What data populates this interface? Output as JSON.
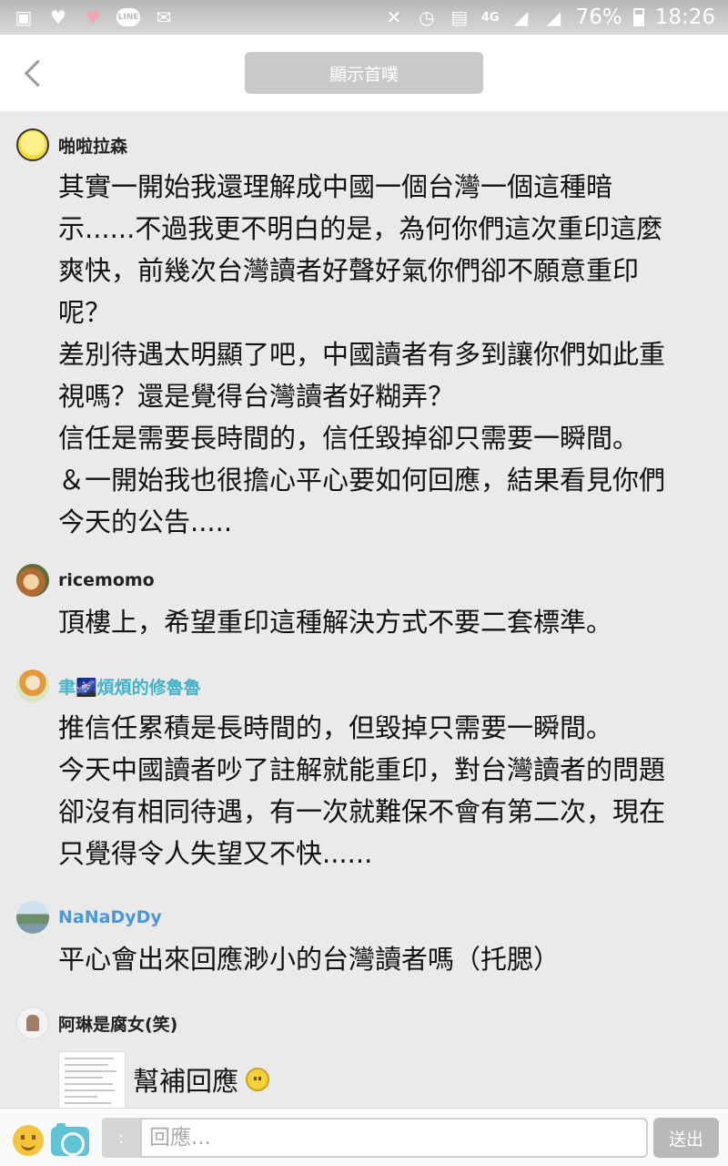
{
  "status_bar": {
    "icons": [
      "image-icon",
      "heart-icon",
      "heart-pink-icon",
      "line-icon",
      "mail-icon",
      "mute-icon",
      "alarm-icon",
      "nfc-icon"
    ],
    "line_label": "LINE",
    "network": "4G",
    "battery": "76%",
    "time": "18:26"
  },
  "header": {
    "show_top_label": "顯示首噗"
  },
  "comments": [
    {
      "name": "啪啦拉森",
      "text": "其實一開始我還理解成中國一個台灣一個這種暗\n示......不過我更不明白的是，為何你們這次重印這麼\n爽快，前幾次台灣讀者好聲好氣你們卻不願意重印\n呢？\n差別待遇太明顯了吧，中國讀者有多到讓你們如此重\n視嗎？還是覺得台灣讀者好糊弄？\n信任是需要長時間的，信任毀掉卻只需要一瞬間。\n＆一開始我也很擔心平心要如何回應，結果看見你們\n今天的公告....."
    },
    {
      "name": "ricemomo",
      "text": "頂樓上，希望重印這種解決方式不要二套標準。"
    },
    {
      "name": "聿🌌煩煩的修魯魯",
      "text": "推信任累積是長時間的，但毀掉只需要一瞬間。\n今天中國讀者吵了註解就能重印，對台灣讀者的問題\n卻沒有相同待遇，有一次就難保不會有第二次，現在\n只覺得令人失望又不快......"
    },
    {
      "name": "NaNaDyDy",
      "text": "平心會出來回應渺小的台灣讀者嗎（托腮）"
    },
    {
      "name": "阿琳是腐女(笑)",
      "text": "幫補回應"
    }
  ],
  "bottom_bar": {
    "sticker_label": ":",
    "reply_placeholder": "回應...",
    "send_label": "送出"
  }
}
